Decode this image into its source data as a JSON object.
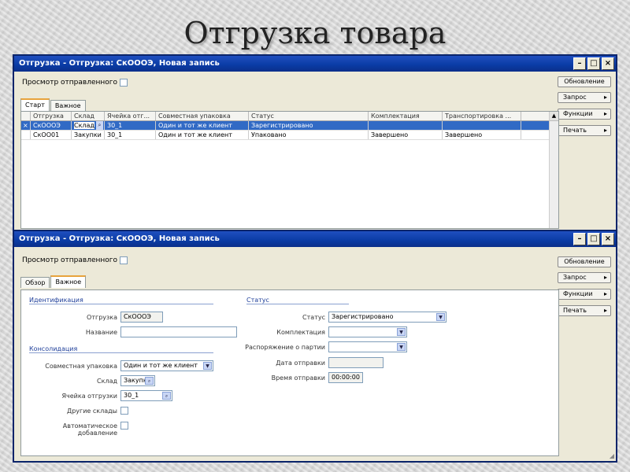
{
  "slide_title": "Отгрузка товара",
  "window1": {
    "title": "Отгрузка - Отгрузка: СкОООЭ, Новая запись",
    "preview_label": "Просмотр отправленного",
    "tabs": [
      "Старт",
      "Важное"
    ],
    "side_buttons": {
      "primary": "Обновление",
      "request": "Запрос",
      "functions": "Функции",
      "print": "Печать"
    },
    "grid": {
      "columns": [
        "Отгрузка",
        "Склад",
        "Ячейка отг...",
        "Совместная упаковка",
        "Статус",
        "Комплектация",
        "Транспортировка ..."
      ],
      "rows": [
        {
          "marker": "×",
          "cells": [
            "СкОООЭ",
            "Склад",
            "30_1",
            "Один и тот же клиент",
            "Зарегистрировано",
            "",
            ""
          ],
          "selected": true
        },
        {
          "marker": "",
          "cells": [
            "СкОО01",
            "Закупки",
            "30_1",
            "Один и тот же клиент",
            "Упаковано",
            "Завершено",
            "Завершено"
          ],
          "selected": false
        }
      ]
    }
  },
  "window2": {
    "title": "Отгрузка - Отгрузка: СкОООЭ, Новая запись",
    "preview_label": "Просмотр отправленного",
    "tabs": [
      "Обзор",
      "Важное"
    ],
    "side_buttons": {
      "primary": "Обновление",
      "request": "Запрос",
      "functions": "Функции",
      "print": "Печать"
    },
    "form": {
      "identification_title": "Идентификация",
      "shipment_label": "Отгрузка",
      "shipment_value": "СкОООЭ",
      "name_label": "Название",
      "name_value": "",
      "consolidation_title": "Консолидация",
      "joint_pack_label": "Совместная упаковка",
      "joint_pack_value": "Один и тот же клиент",
      "warehouse_label": "Склад",
      "warehouse_value": "Закупки",
      "ship_cell_label": "Ячейка отгрузки",
      "ship_cell_value": "30_1",
      "other_wh_label": "Другие склады",
      "auto_add_label": "Автоматическое добавление",
      "status_title": "Статус",
      "status_label": "Статус",
      "status_value": "Зарегистрировано",
      "pick_label": "Комплектация",
      "transport_label": "Распоряжение о партии",
      "ship_date_label": "Дата отправки",
      "ship_time_label": "Время отправки",
      "ship_time_value": "00:00:00"
    }
  }
}
